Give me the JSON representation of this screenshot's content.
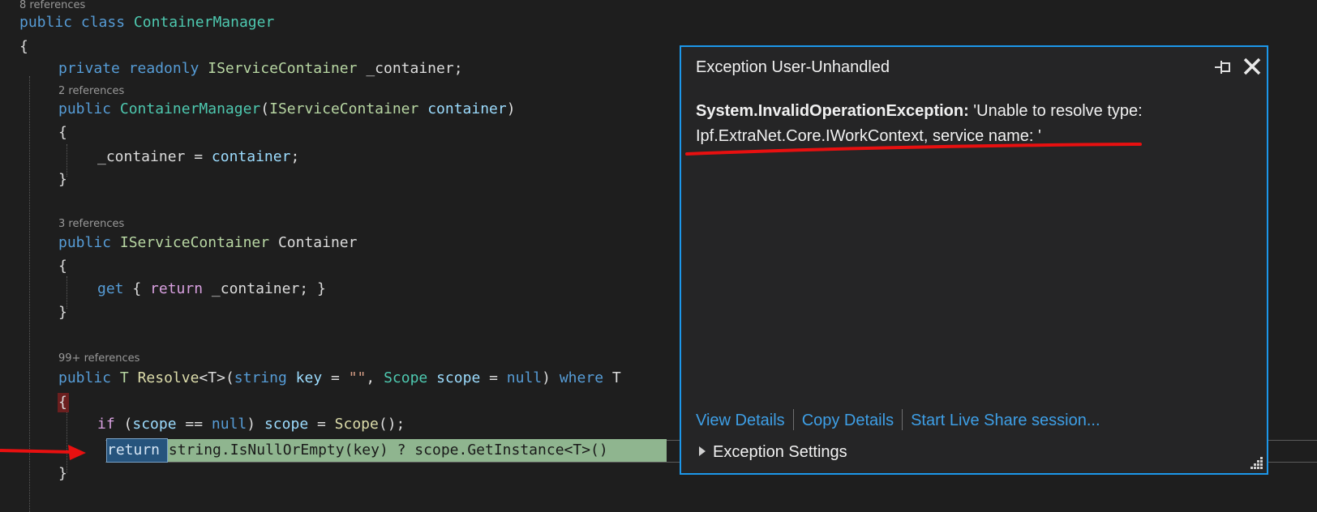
{
  "editor": {
    "codelens": {
      "class_refs": "8 references",
      "ctor_refs": "2 references",
      "prop_refs": "3 references",
      "resolve_refs": "99+ references"
    },
    "tokens": {
      "public": "public",
      "class": "class",
      "private": "private",
      "readonly": "readonly",
      "get": "get",
      "return": "return",
      "string": "string",
      "null": "null",
      "where": "where",
      "if": "if",
      "class_name": "ContainerManager",
      "ctor_name": "ContainerManager",
      "iface": "IServiceContainer",
      "field": "_container",
      "param_container": "container",
      "prop_name": "Container",
      "type_t": "T",
      "resolve_name": "Resolve",
      "generic_t": "<T>",
      "param_key": "key",
      "param_scope": "scope",
      "scope_type": "Scope",
      "empty_str": "\"\"",
      "scope_call": "Scope",
      "get_instance": "GetInstance"
    },
    "punct": {
      "open_brace": "{",
      "close_brace": "}",
      "semi": ";",
      "assign": " = ",
      "space": " ",
      "ctor_open": "(",
      "ctor_close": ")",
      "get_mid": " { ",
      "get_end": "; }",
      "resolve_mid": "(",
      "resolve_after_key": " = ",
      "comma": ", ",
      "resolve_end": ") ",
      "resolve_tail": " T",
      "if_open": " (",
      "eq_null": " == ",
      "if_close": ") ",
      "call_end": "();",
      "tail_code": " string.IsNullOrEmpty(key) ? scope.GetInstance<T>()"
    }
  },
  "exception_popup": {
    "title": "Exception User-Unhandled",
    "exception_type": "System.InvalidOperationException:",
    "message": " 'Unable to resolve type: Ipf.ExtraNet.Core.IWorkContext, service name: '",
    "links": {
      "view_details": "View Details",
      "copy_details": "Copy Details",
      "live_share": "Start Live Share session..."
    },
    "settings_label": "Exception Settings",
    "icons": {
      "pin": "pin-icon",
      "close": "close-icon",
      "expand": "expand-triangle-icon",
      "resize": "resize-grip-icon"
    }
  },
  "colors": {
    "background": "#1e1e1e",
    "keyword": "#569cd6",
    "type": "#4ec9b0",
    "interface": "#b8d7a3",
    "popup_border": "#1c97ea",
    "link": "#3e9fe6",
    "annotation": "#e81010",
    "statement_highlight": "#8fb58f"
  }
}
